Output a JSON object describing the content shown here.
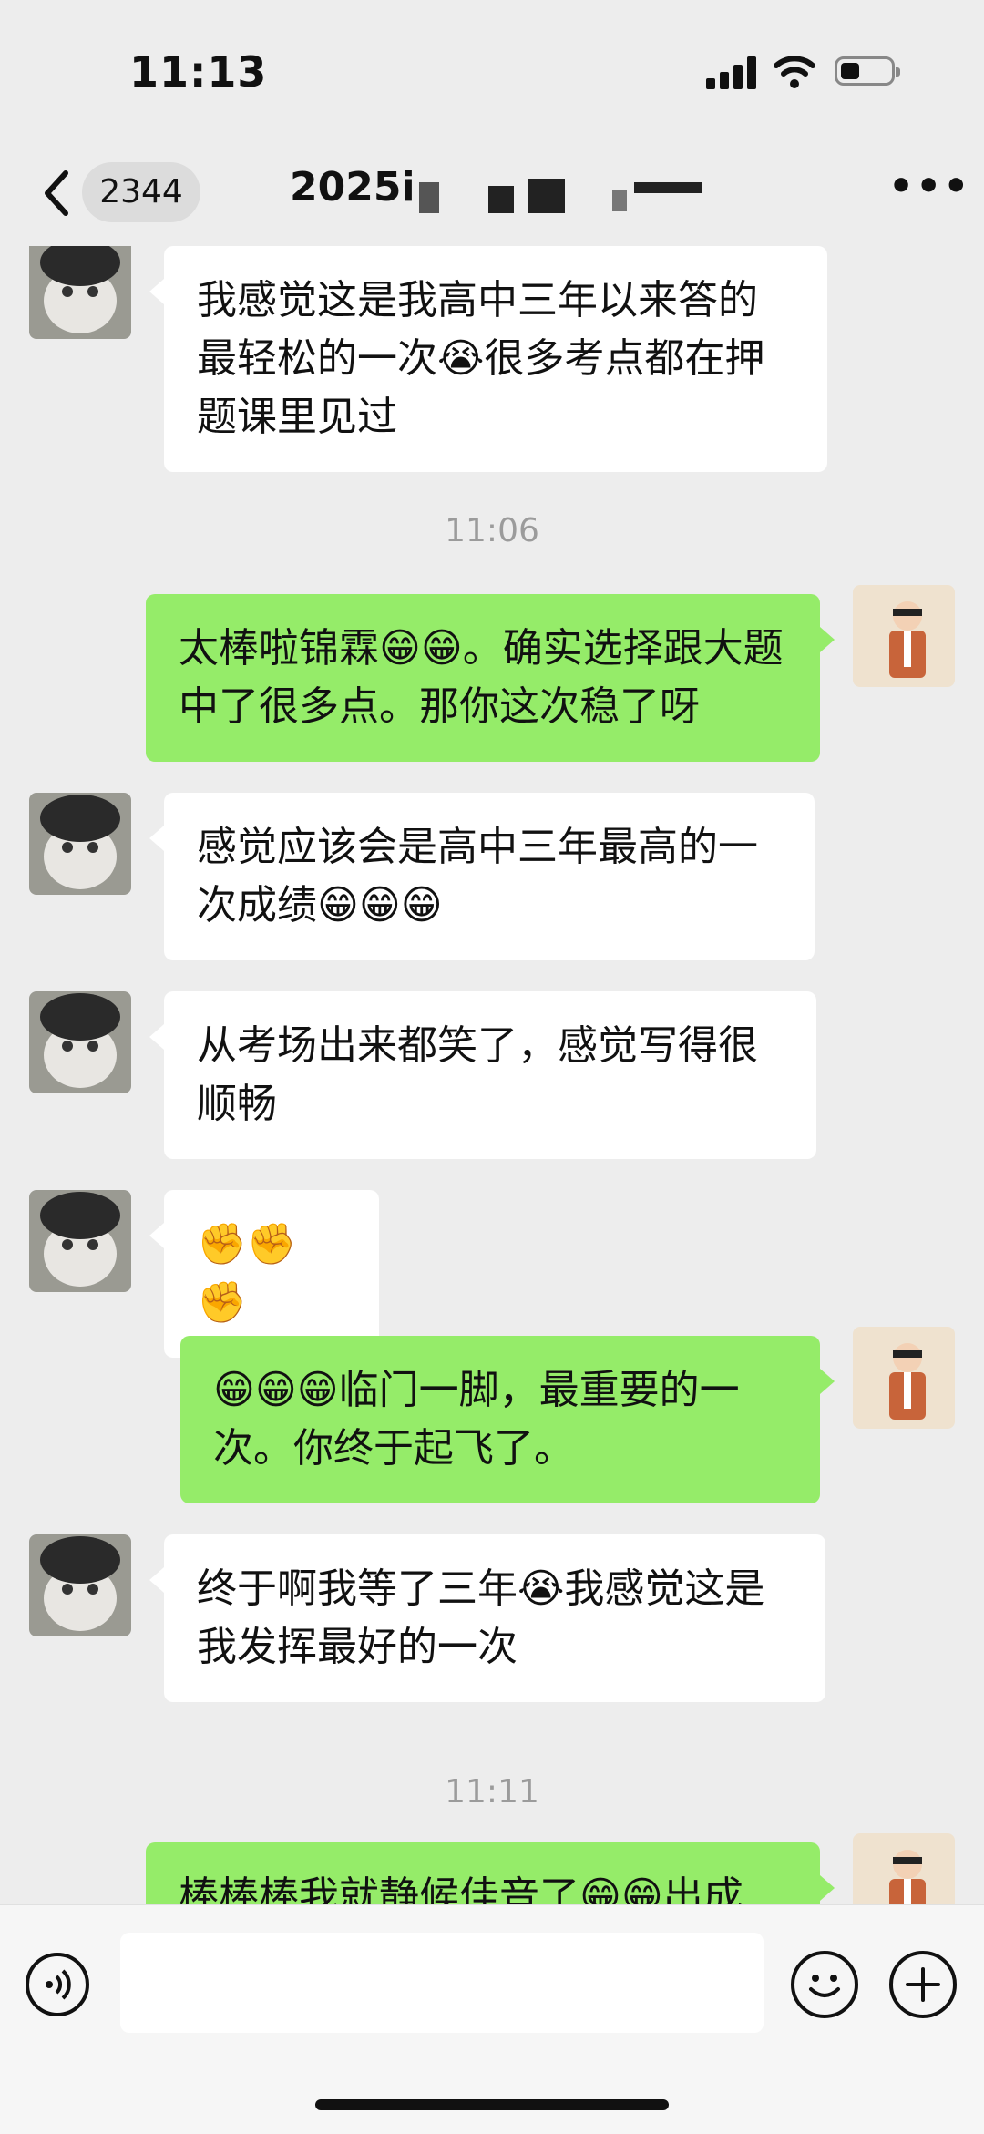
{
  "status_bar": {
    "time": "11:13"
  },
  "nav": {
    "back_count": "2344",
    "title": "2025i",
    "more_icon": "more-horizontal-icon"
  },
  "messages": [
    {
      "from": "them",
      "text": "我感觉这是我高中三年以来答的最轻松的一次😭很多考点都在押题课里见过"
    },
    {
      "timestamp": "11:06"
    },
    {
      "from": "me",
      "text": "太棒啦锦霖😁😁。确实选择跟大题中了很多点。那你这次稳了呀"
    },
    {
      "from": "them",
      "text": "感觉应该会是高中三年最高的一次成绩😁😁😁"
    },
    {
      "from": "them",
      "text": "从考场出来都笑了，感觉写得很顺畅"
    },
    {
      "from": "them",
      "text": "✊✊✊"
    },
    {
      "from": "me",
      "text": "😁😁😁临门一脚，最重要的一次。你终于起飞了。"
    },
    {
      "from": "them",
      "text": "终于啊我等了三年😭我感觉这是我发挥最好的一次"
    },
    {
      "timestamp": "11:11"
    },
    {
      "from": "me",
      "text": "棒棒棒我就静候佳音了😁😁出成"
    }
  ],
  "colors": {
    "background": "#ededed",
    "outgoing_bubble": "#95ec69",
    "incoming_bubble": "#ffffff"
  },
  "input_bar": {
    "voice_icon": "voice-icon",
    "emoji_icon": "emoji-icon",
    "plus_icon": "plus-icon"
  }
}
